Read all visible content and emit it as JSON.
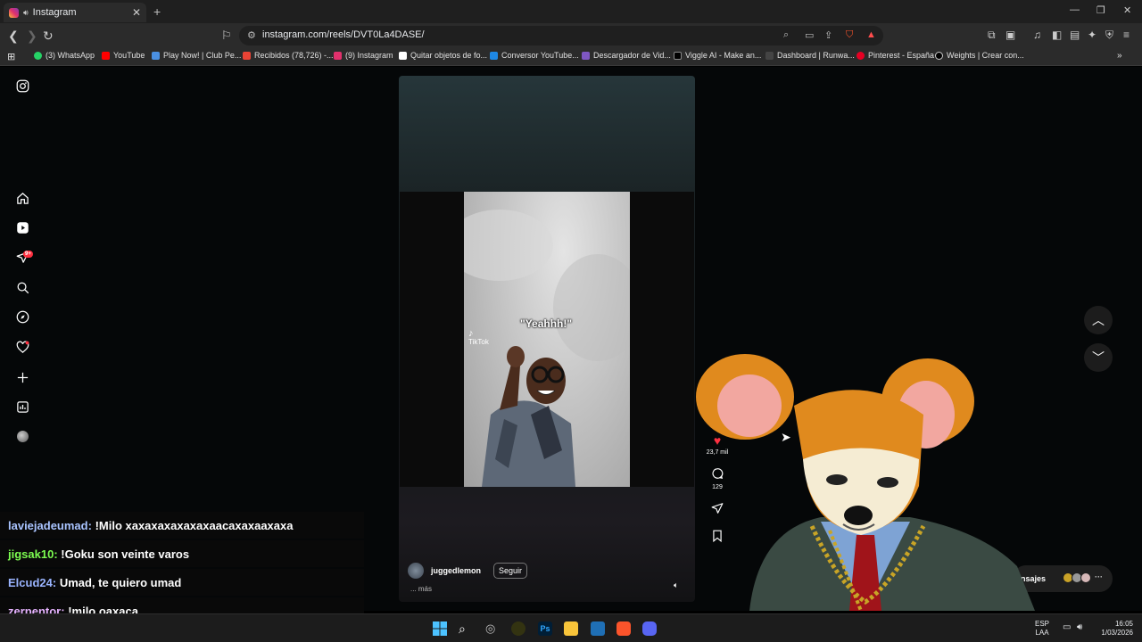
{
  "browser": {
    "tab_title": "Instagram",
    "tab_close": "✕",
    "new_tab": "+",
    "url": "instagram.com/reels/DVT0La4DASE/",
    "bookmarks": [
      {
        "label": "(3) WhatsApp",
        "color": "#25d366"
      },
      {
        "label": "YouTube",
        "color": "#ff0000"
      },
      {
        "label": "Play Now! | Club Pe...",
        "color": "#4a90e2"
      },
      {
        "label": "Recibidos (78,726) -...",
        "color": "#ea4335"
      },
      {
        "label": "(9) Instagram",
        "color": "#e1306c"
      },
      {
        "label": "Quitar objetos de fo...",
        "color": "#ffffff"
      },
      {
        "label": "Conversor YouTube...",
        "color": "#1e88e5"
      },
      {
        "label": "Descargador de Vid...",
        "color": "#7e57c2"
      },
      {
        "label": "Viggle AI - Make an...",
        "color": "#000000"
      },
      {
        "label": "Dashboard | Runwa...",
        "color": "#444444"
      },
      {
        "label": "Pinterest - España",
        "color": "#e60023"
      },
      {
        "label": "Weights | Crear con...",
        "color": "#000000"
      }
    ]
  },
  "sidebar": {
    "notification_badge": "9+"
  },
  "reel": {
    "caption": "\"Yeahhh!\"",
    "watermark": "TikTok",
    "likes": "23,7 mil",
    "comments": "129",
    "username": "juggedlemon",
    "follow_label": "Seguir",
    "more_label": "... más"
  },
  "chat": [
    {
      "user": "laviejadeumad",
      "color": "#a9c4ff",
      "message": "!Milo xaxaxaxaxaxaxaacaxaxaaxaxa"
    },
    {
      "user": "jigsak10",
      "color": "#7cfc50",
      "message": "!Goku son veinte varos"
    },
    {
      "user": "Elcud24",
      "color": "#9ab4ff",
      "message": "Umad, te quiero umad"
    },
    {
      "user": "zerpentor",
      "color": "#e6b3ff",
      "message": "!milo oaxaca"
    }
  ],
  "messages": {
    "label": "ensajes"
  },
  "taskbar": {
    "lang_top": "ESP",
    "lang_bottom": "LAA",
    "time": "16:05",
    "date": "1/03/2026"
  }
}
